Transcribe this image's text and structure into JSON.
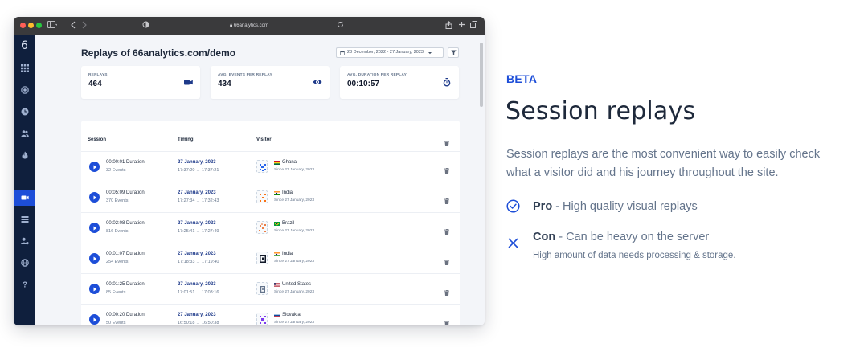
{
  "browser": {
    "url": "66analytics.com"
  },
  "sidebar": {
    "logo": "6",
    "items": [
      {
        "icon": "grid-icon"
      },
      {
        "icon": "target-icon"
      },
      {
        "icon": "clock-icon"
      },
      {
        "icon": "users-icon"
      },
      {
        "icon": "flame-icon"
      },
      {
        "icon": "video-icon",
        "active": true
      },
      {
        "icon": "list-icon"
      },
      {
        "icon": "user-settings-icon"
      },
      {
        "icon": "globe-icon"
      },
      {
        "icon": "help-icon"
      }
    ]
  },
  "app": {
    "title": "Replays of 66analytics.com/demo",
    "date_range": "28 December, 2022 - 27 January, 2023",
    "stats": [
      {
        "label": "REPLAYS",
        "value": "464",
        "icon": "video-icon"
      },
      {
        "label": "AVG. EVENTS PER REPLAY",
        "value": "434",
        "icon": "eye-icon"
      },
      {
        "label": "AVG. DURATION PER REPLAY",
        "value": "00:10:57",
        "icon": "stopwatch-icon"
      }
    ],
    "table": {
      "headers": {
        "session": "Session",
        "timing": "Timing",
        "visitor": "Visitor"
      },
      "rows": [
        {
          "duration": "00:00:01 Duration",
          "events": "32 Events",
          "date": "27 January, 2023",
          "range": "17:37:20 → 17:37:21",
          "country": "Ghana",
          "since": "Since 27 January, 2023"
        },
        {
          "duration": "00:05:09 Duration",
          "events": "370 Events",
          "date": "27 January, 2023",
          "range": "17:27:34 → 17:32:43",
          "country": "India",
          "since": "Since 27 January, 2023"
        },
        {
          "duration": "00:02:08 Duration",
          "events": "816 Events",
          "date": "27 January, 2023",
          "range": "17:25:41 → 17:27:49",
          "country": "Brazil",
          "since": "Since 27 January, 2023"
        },
        {
          "duration": "00:01:07 Duration",
          "events": "254 Events",
          "date": "27 January, 2023",
          "range": "17:18:33 → 17:19:40",
          "country": "India",
          "since": "Since 27 January, 2023"
        },
        {
          "duration": "00:01:25 Duration",
          "events": "85 Events",
          "date": "27 January, 2023",
          "range": "17:01:51 → 17:03:16",
          "country": "United States",
          "since": "Since 27 January, 2023"
        },
        {
          "duration": "00:00:20 Duration",
          "events": "50 Events",
          "date": "27 January, 2023",
          "range": "16:50:18 → 16:50:38",
          "country": "Slovakia",
          "since": "Since 27 January, 2023"
        }
      ]
    }
  },
  "feature": {
    "tag": "BETA",
    "heading": "Session replays",
    "description": "Session replays are the most convenient way to easily check what a visitor did and his journey throughout the site.",
    "pro_label": "Pro",
    "pro_text": " - High quality visual replays",
    "con_label": "Con",
    "con_text": " - Can be heavy on the server",
    "con_note": "High amount of data needs processing & storage.",
    "accent_color": "#1d4ed8"
  }
}
